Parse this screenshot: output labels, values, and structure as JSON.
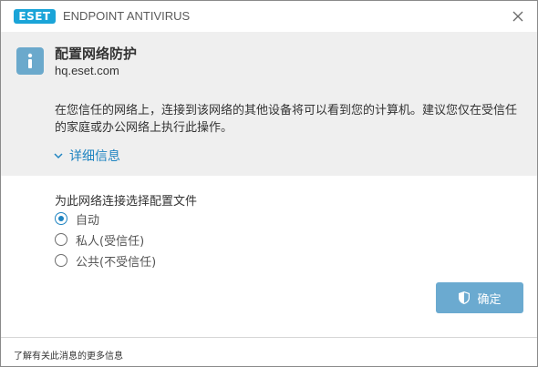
{
  "titlebar": {
    "logo_text": "eset",
    "logo_color": "#1aa4d8",
    "app_title": "ENDPOINT ANTIVIRUS",
    "close_icon": "close-icon"
  },
  "header": {
    "icon": "info-icon",
    "icon_color": "#6ba9cc",
    "title": "配置网络防护",
    "subtitle": "hq.eset.com",
    "description": "在您信任的网络上，连接到该网络的其他设备将可以看到您的计算机。建议您仅在受信任的家庭或办公网络上执行此操作。",
    "details_label": "详细信息",
    "details_icon": "chevron-down-icon",
    "link_color": "#1f84c1"
  },
  "profile": {
    "prompt": "为此网络连接选择配置文件",
    "options": [
      {
        "label": "自动",
        "checked": true
      },
      {
        "label": "私人(受信任)",
        "checked": false
      },
      {
        "label": "公共(不受信任)",
        "checked": false
      }
    ]
  },
  "actions": {
    "ok_label": "确定",
    "ok_icon": "shield-icon",
    "button_color": "#6baad0"
  },
  "footer": {
    "link_text": "了解有关此消息的更多信息"
  }
}
